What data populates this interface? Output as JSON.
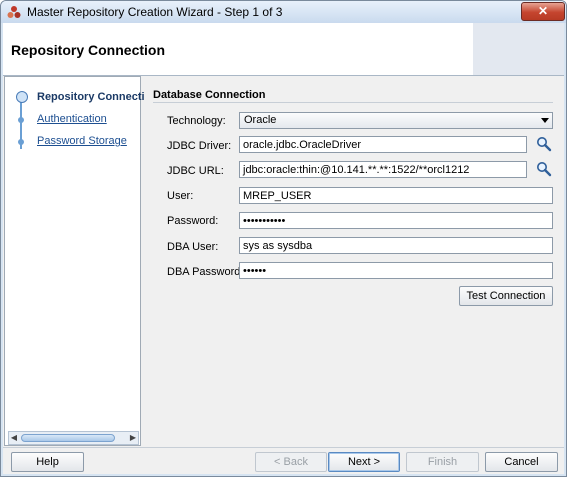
{
  "window": {
    "title": "Master Repository Creation Wizard - Step 1 of 3",
    "close_label": "✕"
  },
  "header": {
    "title": "Repository Connection"
  },
  "nav": {
    "items": [
      {
        "label": "Repository Connecti",
        "state": "current"
      },
      {
        "label": "Authentication",
        "state": "link"
      },
      {
        "label": "Password Storage",
        "state": "link"
      }
    ]
  },
  "form": {
    "section_title": "Database Connection",
    "technology": {
      "label": "Technology:",
      "value": "Oracle"
    },
    "jdbc_driver": {
      "label": "JDBC Driver:",
      "value": "oracle.jdbc.OracleDriver"
    },
    "jdbc_url": {
      "label": "JDBC URL:",
      "value": "jdbc:oracle:thin:@10.141.**.**:1522/**orcl1212"
    },
    "user": {
      "label": "User:",
      "value": "MREP_USER"
    },
    "password": {
      "label": "Password:",
      "value": "•••••••••••"
    },
    "dba_user": {
      "label": "DBA User:",
      "value": "sys as sysdba"
    },
    "dba_password": {
      "label": "DBA Password:",
      "value": "••••••"
    },
    "test_connection": "Test Connection"
  },
  "footer": {
    "help": "Help",
    "back": "< Back",
    "next": "Next >",
    "finish": "Finish",
    "cancel": "Cancel"
  },
  "icons": {
    "app": "wizard-app-icon",
    "search": "magnifier-icon"
  }
}
